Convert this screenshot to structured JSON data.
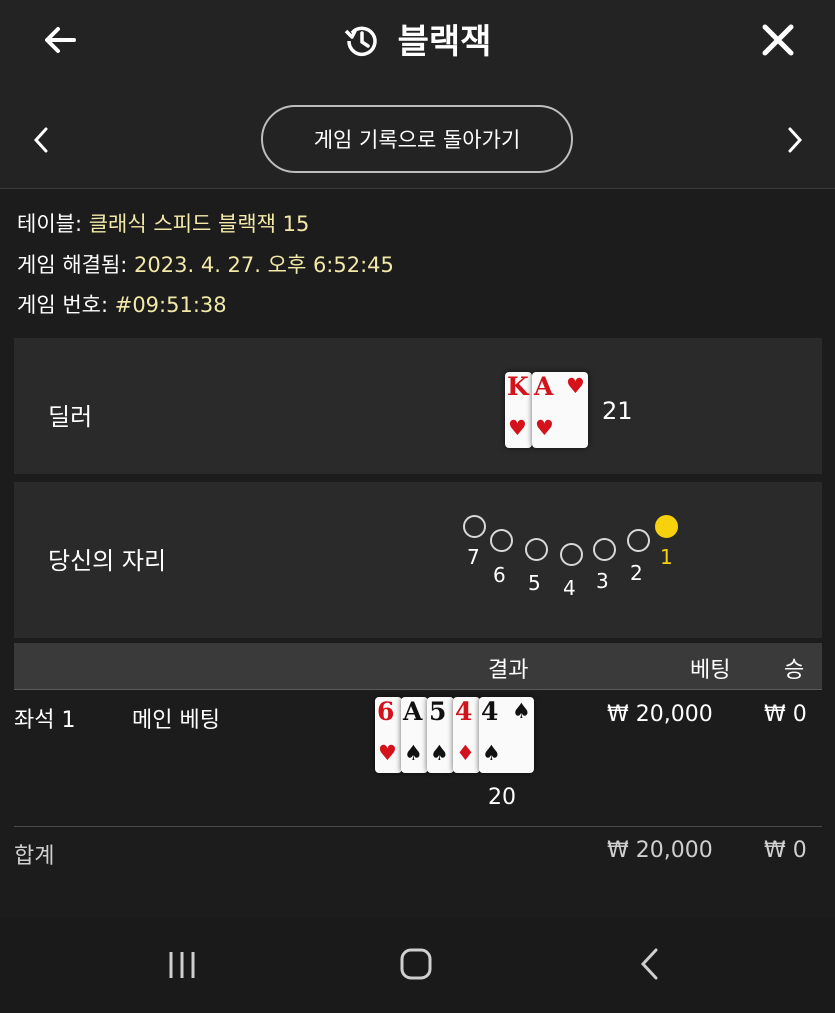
{
  "header": {
    "title": "블랙잭",
    "back_icon": "arrow-left-icon",
    "history_icon": "history-icon",
    "close_icon": "close-icon"
  },
  "subnav": {
    "button_label": "게임 기록으로 돌아가기",
    "prev_icon": "chevron-left-icon",
    "next_icon": "chevron-right-icon"
  },
  "info": {
    "table_label": "테이블:",
    "table_value": "클래식 스피드 블랙잭 15",
    "resolved_label": "게임 해결됨:",
    "resolved_value": "2023. 4. 27. 오후 6:52:45",
    "number_label": "게임 번호:",
    "number_value": "#09:51:38"
  },
  "dealer": {
    "label": "딜러",
    "cards": [
      {
        "rank": "K",
        "suit": "♥",
        "color": "#d3121c"
      },
      {
        "rank": "A",
        "suit": "♥",
        "color": "#d3121c"
      }
    ],
    "total": "21"
  },
  "seats": {
    "label": "당신의 자리",
    "numbers": [
      "7",
      "6",
      "5",
      "4",
      "3",
      "2",
      "1"
    ],
    "active": "1",
    "active_color": "#f5d20c"
  },
  "results": {
    "headers": {
      "result": "결과",
      "bet": "베팅",
      "win": "승"
    },
    "rows": [
      {
        "seat": "좌석 1",
        "type": "메인 베팅",
        "cards": [
          {
            "rank": "6",
            "suit": "♥",
            "color": "#d3121c"
          },
          {
            "rank": "A",
            "suit": "♠",
            "color": "#111111"
          },
          {
            "rank": "5",
            "suit": "♠",
            "color": "#111111"
          },
          {
            "rank": "4",
            "suit": "♦",
            "color": "#d3121c"
          },
          {
            "rank": "4",
            "suit": "♠",
            "color": "#111111"
          }
        ],
        "hand_total": "20",
        "bet": "₩ 20,000",
        "win": "₩ 0"
      }
    ],
    "total_label": "합계",
    "total_bet": "₩ 20,000",
    "total_win": "₩ 0"
  },
  "system_nav": {
    "recent_icon": "recent-apps-icon",
    "home_icon": "home-icon",
    "back_icon": "back-icon"
  }
}
